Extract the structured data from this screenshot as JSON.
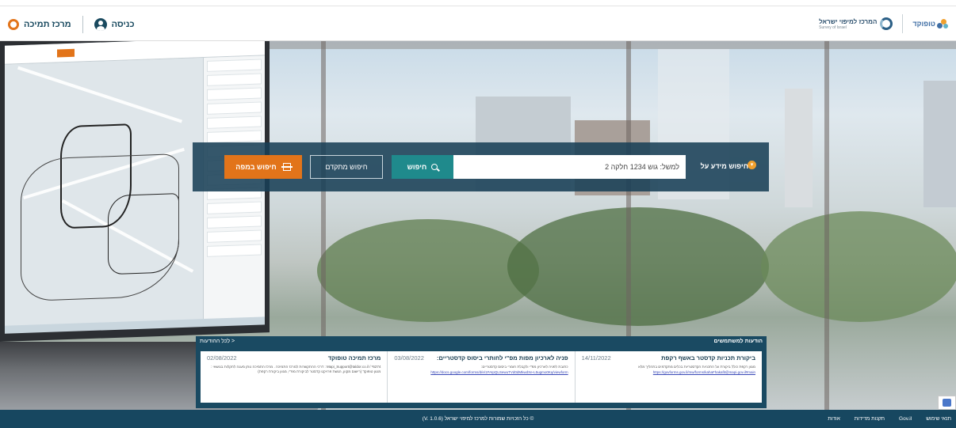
{
  "header": {
    "support_label": "מרכז תמיכה",
    "login_label": "כניסה",
    "mapi_logo_text": "המרכז למיפוי ישראל",
    "mapi_logo_sub": "Survey of Israel",
    "topo_logo_text": "טופוקד"
  },
  "search": {
    "label": "חיפוש מידע על",
    "input_placeholder": "למשל: גוש 1234 חלקה 2",
    "search_button": "חיפוש",
    "advanced_button": "חיפוש מתקדם",
    "map_button": "חיפוש במפה"
  },
  "announcements": {
    "title": "הודעות למשתמשים",
    "all_link": "לכל ההודעות >",
    "items": [
      {
        "title": "ביקורת תכניות קדסטר באשף רקפת",
        "date": "14/11/2022",
        "body": "מגוון רקפת כולל ביקורת על התכניות הקדסטריות בכלים מתקדמים בתהליך מלא",
        "link": "https://govforms.gov.il/mw/forms/kahaFhakafit@mapi.gov.il#main"
      },
      {
        "title": "פניה לארכיון מפות מפ\"י לחותרי ביסוס קדסטריים:",
        "date": "03/08/2022",
        "body": "כתובת לפניה לארכיון מפ\"י ולקבלת חומרי ביסוס קדסטריים:",
        "link": "https://docs.google.com/forms/d/e/1FAIpQLSewuTVd0dMkwdXe-L5ugmo0Kq/viewform"
      },
      {
        "title": "מרכז תמיכה טופוקד",
        "date": "02/08/2022",
        "body": "Mapi_Support@taldor.co.il / *6274 : דרכי ההתקשרות למרכז התמיכה . מרכז התמיכה נותן מענה לתקלות בנושאי : מגוון טופוקד (רישום מקוון, הגשת פרויקט קדסטר לביקורת מפ\"י, מגוון ביקורת רקפת)",
        "link": ""
      }
    ]
  },
  "footer": {
    "copyright": "© כל הזכויות שמורות למרכז למיפוי ישראל (V. 1.0.6)",
    "links": [
      "אודות",
      "תקנות מדידות",
      "Gov.il",
      "תנאי שימוש"
    ]
  },
  "colors": {
    "brand_dark": "#174760",
    "accent_orange": "#e2741a",
    "search_teal": "#1f8a8c"
  }
}
